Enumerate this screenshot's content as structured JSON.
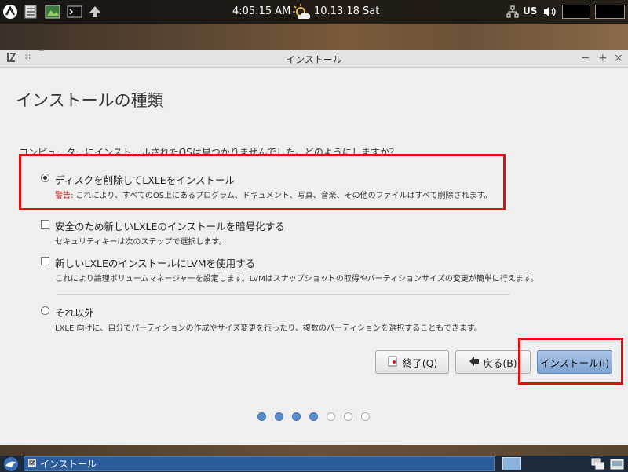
{
  "panel": {
    "clock": "4:05:15 AM",
    "date": "10.13.18 Sat",
    "keyboard": "US"
  },
  "window": {
    "title": "インストール"
  },
  "page": {
    "title": "インストールの種類",
    "question": "コンピューターにインストールされたOSは見つかりませんでした。どのようにしますか？"
  },
  "options": [
    {
      "label": "ディスクを削除してLXLEをインストール",
      "warning_prefix": "警告:",
      "desc": " これにより、すべてのOS上にあるプログラム、ドキュメント、写真、音楽、その他のファイルはすべて削除されます。",
      "selected": true
    },
    {
      "label": "安全のため新しいLXLEのインストールを暗号化する",
      "desc": "セキュリティキーは次のステップで選択します。"
    },
    {
      "label": "新しいLXLEのインストールにLVMを使用する",
      "desc": "これにより論理ボリュームマネージャーを設定します。LVMはスナップショットの取得やパーティションサイズの変更が簡単に行えます。"
    },
    {
      "label": "それ以外",
      "desc": "LXLE 向けに、自分でパーティションの作成やサイズ変更を行ったり、複数のパーティションを選択することもできます。"
    }
  ],
  "buttons": {
    "quit": "終了(Q)",
    "back": "戻る(B)",
    "install": "インストール(I)"
  },
  "progress": {
    "current_step": 4,
    "total_steps": 7
  },
  "taskbar": {
    "task_label": "インストール"
  },
  "colors": {
    "highlight": "#e01010",
    "primary_button": "#7ea4d2",
    "step_active": "#5a8ccc"
  }
}
